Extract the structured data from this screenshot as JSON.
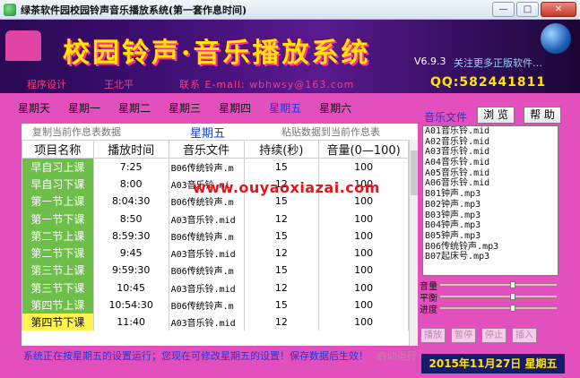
{
  "window": {
    "title": "绿茶软件园校园铃声音乐播放系统(第一套作息时间)",
    "minimize": "—",
    "maximize": "□",
    "close": "✕"
  },
  "banner": {
    "title": "校园铃声·音乐播放系统",
    "version": "V6.9.3",
    "follow_text": "关注更多正版软件…",
    "design_label": "程序设计",
    "author": "王北平",
    "email": "联系 E-mail: wbhwsy@163.com",
    "qq": "QQ:582441811"
  },
  "tabs": [
    "星期天",
    "星期一",
    "星期二",
    "星期三",
    "星期四",
    "星期五",
    "星期六"
  ],
  "active_tab_index": 5,
  "panel": {
    "copy_link": "复制当前作息表数据",
    "day_title": "星期五",
    "paste_link": "粘贴数据到当前作息表"
  },
  "table": {
    "headers": [
      "项目名称",
      "播放时间",
      "音乐文件",
      "持续(秒)",
      "音量(0—100)"
    ],
    "rows": [
      {
        "name": "早自习上课",
        "time": "7:25",
        "file": "B06传统铃声.m",
        "dur": "15",
        "vol": "100"
      },
      {
        "name": "早自习下课",
        "time": "8:00",
        "file": "A03音乐铃.mi",
        "dur": "12",
        "vol": "100"
      },
      {
        "name": "第一节上课",
        "time": "8:04:30",
        "file": "B06传统铃声.m",
        "dur": "15",
        "vol": "100"
      },
      {
        "name": "第一节下课",
        "time": "8:50",
        "file": "A03音乐铃.mid",
        "dur": "12",
        "vol": "100"
      },
      {
        "name": "第二节上课",
        "time": "8:59:30",
        "file": "B06传统铃声.m",
        "dur": "15",
        "vol": "100"
      },
      {
        "name": "第二节下课",
        "time": "9:45",
        "file": "A03音乐铃.mid",
        "dur": "12",
        "vol": "100"
      },
      {
        "name": "第三节上课",
        "time": "9:59:30",
        "file": "B06传统铃声.m",
        "dur": "15",
        "vol": "100"
      },
      {
        "name": "第三节下课",
        "time": "10:45",
        "file": "A03音乐铃.mid",
        "dur": "12",
        "vol": "100"
      },
      {
        "name": "第四节上课",
        "time": "10:54:30",
        "file": "B06传统铃声.m",
        "dur": "15",
        "vol": "100"
      },
      {
        "name": "第四节下课",
        "time": "11:40",
        "file": "A03音乐铃.mid",
        "dur": "12",
        "vol": "100"
      }
    ],
    "selected_row_index": 9
  },
  "watermark": "www.ouyaoxiazai.com",
  "music": {
    "label": "音乐文件",
    "browse": "浏 览",
    "help": "帮 助",
    "files": [
      "A01音乐铃.mid",
      "A02音乐铃.mid",
      "A03音乐铃.mid",
      "A04音乐铃.mid",
      "A05音乐铃.mid",
      "A06音乐铃.mid",
      "B01钟声.mp3",
      "B02钟声.mp3",
      "B03钟声.mp3",
      "B04钟声.mp3",
      "B05钟声.mp3",
      "B06传统铃声.mp3",
      "B07起床号.mp3"
    ]
  },
  "sliders": {
    "volume_label": "音量",
    "balance_label": "平衡",
    "progress_label": "进度",
    "volume_level": 0.62,
    "balance_level": 0.62,
    "progress_level": 0.62
  },
  "controls": [
    "播放",
    "暂停",
    "停止",
    "插入"
  ],
  "status": "系统正在按星期五的设置运行；您现在可修改星期五的设置！保存数据后生效！",
  "status_link": "启动运行",
  "date": "2015年11月27日  星期五",
  "colors": {
    "accent": "#1a3cd6",
    "name_cell": "#6ebf4a",
    "selected": "#fff44f",
    "background": "#e34fbc",
    "banner_title": "#ffe600"
  }
}
